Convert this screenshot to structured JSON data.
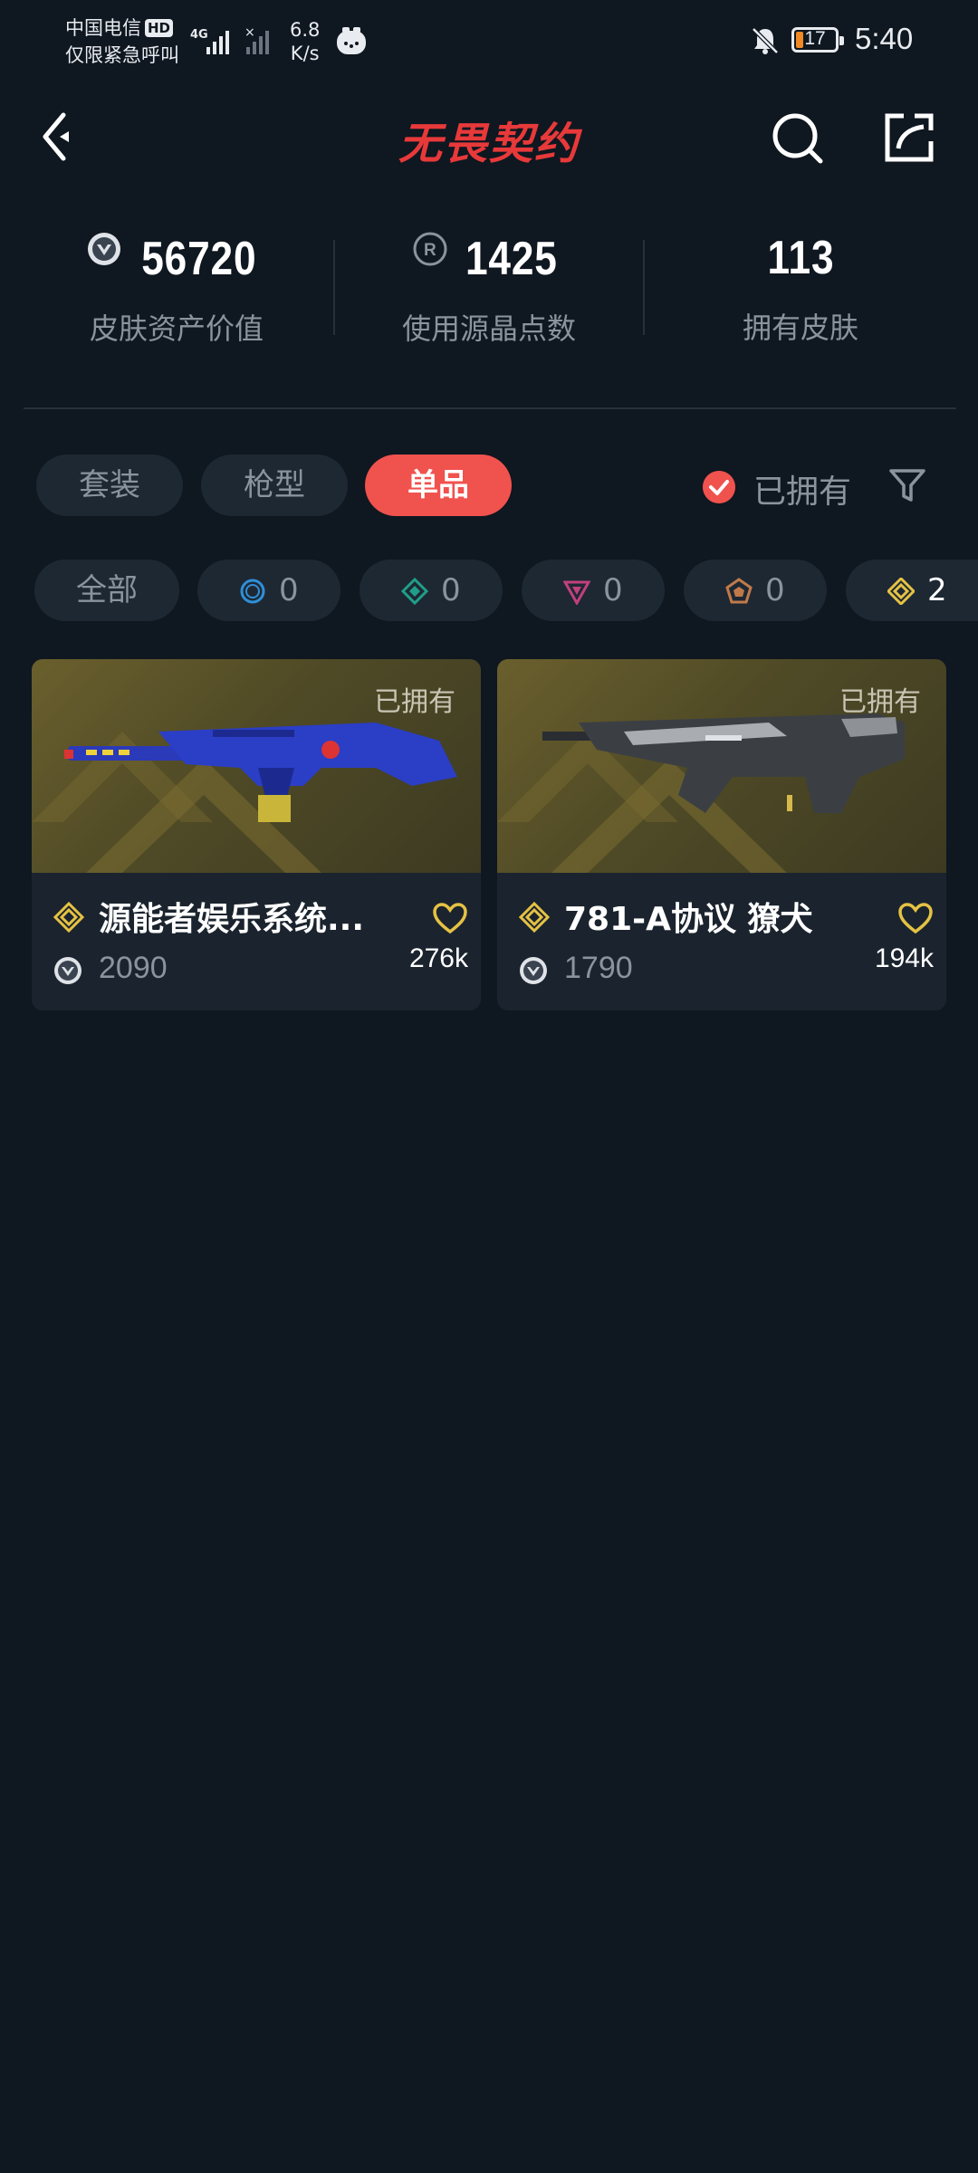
{
  "status_bar": {
    "carrier_line1": "中国电信",
    "carrier_badge": "HD",
    "carrier_line2": "仅限紧急呼叫",
    "net_type": "4G",
    "speed_value": "6.8",
    "speed_unit": "K/s",
    "battery": "17",
    "time": "5:40"
  },
  "header": {
    "logo": "无畏契约",
    "back_icon": "chevron-left-icon",
    "search_icon": "search-icon",
    "share_icon": "share-icon"
  },
  "stats": [
    {
      "value": "56720",
      "label": "皮肤资产价值",
      "icon": "valorant-point-icon"
    },
    {
      "value": "1425",
      "label": "使用源晶点数",
      "icon": "radianite-icon"
    },
    {
      "value": "113",
      "label": "拥有皮肤"
    }
  ],
  "type_tabs": [
    {
      "label": "套装",
      "active": false
    },
    {
      "label": "枪型",
      "active": false
    },
    {
      "label": "单品",
      "active": true
    }
  ],
  "owned_filter": {
    "label": "已拥有",
    "checked": true
  },
  "rarity_filters": [
    {
      "label": "全部"
    },
    {
      "count": "0",
      "icon": "select-tier-icon",
      "color": "#2f8fd8"
    },
    {
      "count": "0",
      "icon": "deluxe-tier-icon",
      "color": "#1f9f8a"
    },
    {
      "count": "0",
      "icon": "premium-tier-icon",
      "color": "#c2407e"
    },
    {
      "count": "0",
      "icon": "exclusive-tier-icon",
      "color": "#c07a4a"
    },
    {
      "count": "2",
      "icon": "ultra-tier-icon",
      "color": "#e5c244"
    }
  ],
  "cards": [
    {
      "name": "源能者娱乐系统...",
      "price": "2090",
      "likes": "276k",
      "owned_tag": "已拥有",
      "tier_color": "#e5c244"
    },
    {
      "name": "781-A协议 獠犬",
      "price": "1790",
      "likes": "194k",
      "owned_tag": "已拥有",
      "tier_color": "#e5c244"
    }
  ],
  "colors": {
    "background": "#0f1720",
    "accent": "#f0524e",
    "logo_red": "#e8393a",
    "muted_text": "#8b939d",
    "pill_bg": "#1e2833",
    "card_bg": "#1b242e",
    "ultra_gold": "#e5c244"
  }
}
